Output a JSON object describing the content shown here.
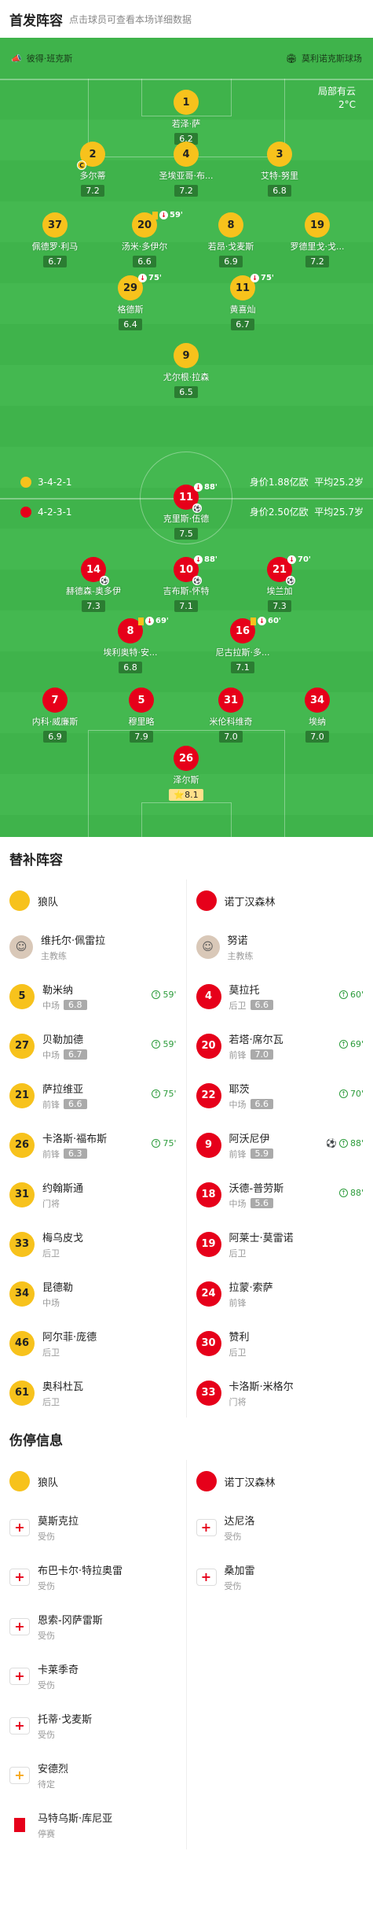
{
  "header": {
    "title": "首发阵容",
    "subtitle": "点击球员可查看本场详细数据"
  },
  "teams": {
    "home": "狼队",
    "away": "诺丁汉森林"
  },
  "pitch": {
    "left_team": "彼得·班克斯",
    "right_team": "莫利诺克斯球场",
    "weather": "局部有云",
    "temp": "2°C"
  },
  "colors": {
    "home": "#f7c21c",
    "away": "#e6001a",
    "pitch": "#3fb34b"
  },
  "formation": {
    "home": {
      "shape": "3-4-2-1",
      "value": "身价1.88亿欧",
      "age": "平均25.2岁"
    },
    "away": {
      "shape": "4-2-3-1",
      "value": "身价2.50亿欧",
      "age": "平均25.7岁"
    }
  },
  "home_players": [
    {
      "num": "1",
      "name": "若泽·萨",
      "rate": "6.2"
    },
    {
      "num": "2",
      "name": "多尔蒂",
      "rate": "7.2",
      "capt": "C"
    },
    {
      "num": "4",
      "name": "圣埃亚哥·布...",
      "rate": "7.2"
    },
    {
      "num": "3",
      "name": "艾特-努里",
      "rate": "6.8"
    },
    {
      "num": "37",
      "name": "佩德罗·利马",
      "rate": "6.7"
    },
    {
      "num": "20",
      "name": "汤米·多伊尔",
      "rate": "6.6",
      "evt": "59'",
      "card": true
    },
    {
      "num": "8",
      "name": "若昂·戈麦斯",
      "rate": "6.9"
    },
    {
      "num": "19",
      "name": "罗德里戈·戈...",
      "rate": "7.2"
    },
    {
      "num": "29",
      "name": "格德斯",
      "rate": "6.4",
      "evt": "75'"
    },
    {
      "num": "11",
      "name": "黄喜灿",
      "rate": "6.7",
      "evt": "75'"
    },
    {
      "num": "9",
      "name": "尤尔根·拉森",
      "rate": "6.5"
    }
  ],
  "away_players": [
    {
      "num": "11",
      "name": "克里斯·伍德",
      "rate": "7.5",
      "evt": "88'",
      "goal": true
    },
    {
      "num": "14",
      "name": "赫德森-奥多伊",
      "rate": "7.3",
      "goal": true
    },
    {
      "num": "10",
      "name": "吉布斯-怀特",
      "rate": "7.1",
      "evt": "88'",
      "goal": true
    },
    {
      "num": "21",
      "name": "埃兰加",
      "rate": "7.3",
      "evt": "70'",
      "goal": true
    },
    {
      "num": "8",
      "name": "埃利奥特·安...",
      "rate": "6.8",
      "evt": "69'",
      "card": true
    },
    {
      "num": "16",
      "name": "尼古拉斯·多...",
      "rate": "7.1",
      "evt": "60'",
      "card": true
    },
    {
      "num": "7",
      "name": "内科·威廉斯",
      "rate": "6.9"
    },
    {
      "num": "5",
      "name": "穆里略",
      "rate": "7.9"
    },
    {
      "num": "31",
      "name": "米伦科维奇",
      "rate": "7.0"
    },
    {
      "num": "34",
      "name": "埃纳",
      "rate": "7.0"
    },
    {
      "num": "26",
      "name": "泽尔斯",
      "rate": "8.1",
      "star": true
    }
  ],
  "subs": {
    "title": "替补阵容",
    "coach_label": "主教练",
    "home_coach": "维托尔·佩雷拉",
    "away_coach": "努诺",
    "home": [
      {
        "num": "5",
        "name": "勒米纳",
        "pos": "中场",
        "rate": "6.8",
        "min": "59'"
      },
      {
        "num": "27",
        "name": "贝勒加德",
        "pos": "中场",
        "rate": "6.7",
        "min": "59'"
      },
      {
        "num": "21",
        "name": "萨拉维亚",
        "pos": "前锋",
        "rate": "6.6",
        "min": "75'"
      },
      {
        "num": "26",
        "name": "卡洛斯·福布斯",
        "pos": "前锋",
        "rate": "6.3",
        "min": "75'"
      },
      {
        "num": "31",
        "name": "约翰斯通",
        "pos": "门将"
      },
      {
        "num": "33",
        "name": "梅乌皮戈",
        "pos": "后卫"
      },
      {
        "num": "34",
        "name": "昆德勒",
        "pos": "中场"
      },
      {
        "num": "46",
        "name": "阿尔菲·庞德",
        "pos": "后卫"
      },
      {
        "num": "61",
        "name": "奥科杜瓦",
        "pos": "后卫"
      }
    ],
    "away": [
      {
        "num": "4",
        "name": "莫拉托",
        "pos": "后卫",
        "rate": "6.6",
        "min": "60'"
      },
      {
        "num": "20",
        "name": "若塔·席尔瓦",
        "pos": "前锋",
        "rate": "7.0",
        "min": "69'"
      },
      {
        "num": "22",
        "name": "耶茨",
        "pos": "中场",
        "rate": "6.6",
        "min": "70'"
      },
      {
        "num": "9",
        "name": "阿沃尼伊",
        "pos": "前锋",
        "rate": "5.9",
        "min": "88'",
        "goal": true
      },
      {
        "num": "18",
        "name": "沃德-普劳斯",
        "pos": "中场",
        "rate": "5.6",
        "min": "88'"
      },
      {
        "num": "19",
        "name": "阿莱士·莫雷诺",
        "pos": "后卫"
      },
      {
        "num": "24",
        "name": "拉蒙·索萨",
        "pos": "前锋"
      },
      {
        "num": "30",
        "name": "赞利",
        "pos": "后卫"
      },
      {
        "num": "33",
        "name": "卡洛斯·米格尔",
        "pos": "门将"
      }
    ]
  },
  "injuries": {
    "title": "伤停信息",
    "home": [
      {
        "name": "莫斯克拉",
        "status": "受伤",
        "type": "injury"
      },
      {
        "name": "布巴卡尔·特拉奥雷",
        "status": "受伤",
        "type": "injury"
      },
      {
        "name": "恩索-冈萨雷斯",
        "status": "受伤",
        "type": "injury"
      },
      {
        "name": "卡莱季奇",
        "status": "受伤",
        "type": "injury"
      },
      {
        "name": "托蒂·戈麦斯",
        "status": "受伤",
        "type": "injury"
      },
      {
        "name": "安德烈",
        "status": "待定",
        "type": "doubt"
      },
      {
        "name": "马特乌斯·库尼亚",
        "status": "停赛",
        "type": "suspend"
      }
    ],
    "away": [
      {
        "name": "达尼洛",
        "status": "受伤",
        "type": "injury"
      },
      {
        "name": "桑加雷",
        "status": "受伤",
        "type": "injury"
      }
    ]
  }
}
